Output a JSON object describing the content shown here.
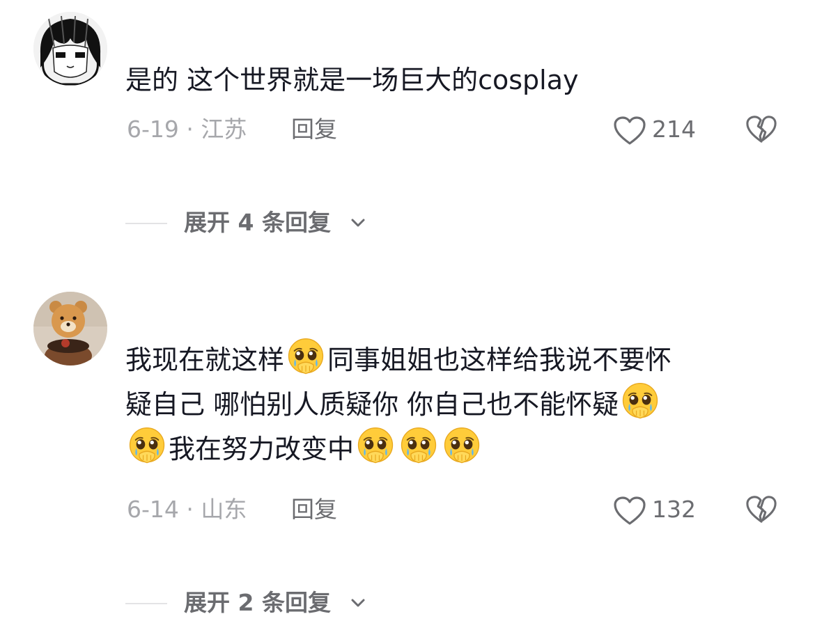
{
  "comments": [
    {
      "text": "是的 这个世界就是一场巨大的cosplay",
      "date_location": "6-19 · 江苏",
      "reply_label": "回复",
      "like_count": "214",
      "expand_label": "展开 4 条回复"
    },
    {
      "text_parts": [
        "我现在就这样",
        "同事姐姐也这样给我说不要怀",
        "疑自己 哪怕别人质疑你 你自己也不能怀疑",
        "我在努力改变中"
      ],
      "emoji_name": "pleading-face-covering-mouth-emoji",
      "date_location": "6-14 · 山东",
      "reply_label": "回复",
      "like_count": "132",
      "expand_label": "展开 2 条回复"
    }
  ],
  "colors": {
    "text": "#161823",
    "meta": "#a6a7ab",
    "action": "#6b6c70"
  }
}
